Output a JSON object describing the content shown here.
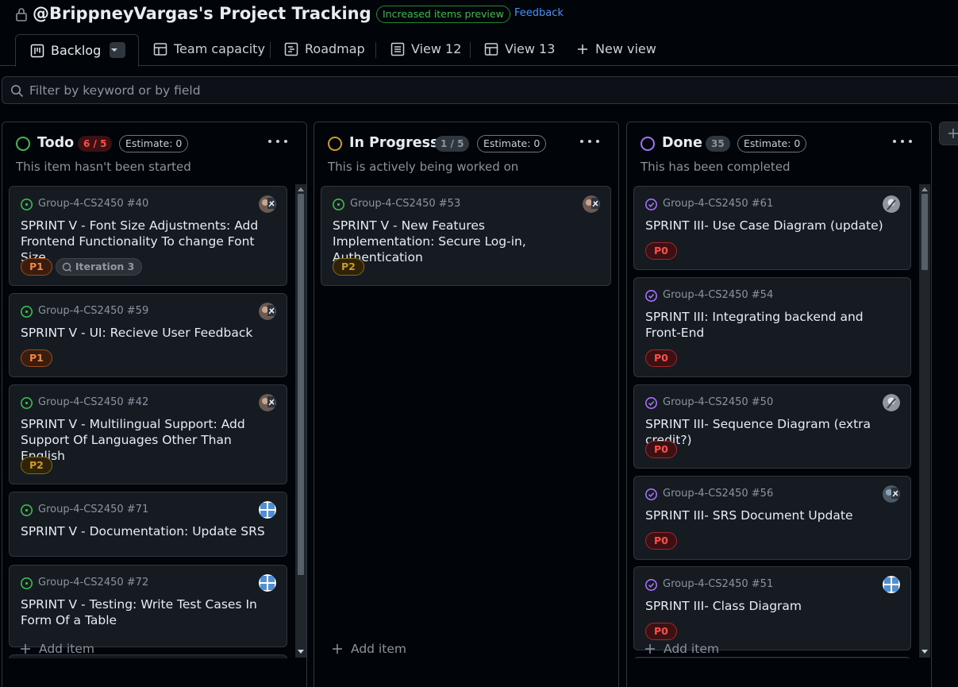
{
  "header": {
    "title": "@BrippneyVargas's Project Tracking",
    "preview_badge": "Increased items preview",
    "feedback_link": "Feedback"
  },
  "tabs": [
    {
      "label": "Backlog",
      "icon": "board-icon",
      "active": true
    },
    {
      "label": "Team capacity",
      "icon": "table-icon"
    },
    {
      "label": "Roadmap",
      "icon": "roadmap-icon"
    },
    {
      "label": "View 12",
      "icon": "list-icon"
    },
    {
      "label": "View 13",
      "icon": "table-icon"
    },
    {
      "label": "New view",
      "icon": "plus-icon"
    }
  ],
  "filter": {
    "placeholder": "Filter by keyword or by field"
  },
  "colors": {
    "todo": "#3fb950",
    "in_progress": "#d29922",
    "done": "#a371f7",
    "accent_link": "#4493f8"
  },
  "columns": [
    {
      "name": "Todo",
      "count": "6 / 5",
      "estimate": "Estimate: 0",
      "description": "This item hasn't been started",
      "add_item": "Add item",
      "cards": [
        {
          "repo": "Group-4-CS2450 #40",
          "title": "SPRINT V - Font Size Adjustments: Add Frontend Functionality To change Font Size",
          "labels": [
            {
              "text": "P1",
              "kind": "p1"
            },
            {
              "text": "Iteration 3",
              "kind": "iter"
            }
          ],
          "avatar": "avatar-pair"
        },
        {
          "repo": "Group-4-CS2450 #59",
          "title": "SPRINT V - UI: Recieve User Feedback",
          "labels": [
            {
              "text": "P1",
              "kind": "p1"
            }
          ],
          "avatar": "avatar-pair"
        },
        {
          "repo": "Group-4-CS2450 #42",
          "title": "SPRINT V - Multilingual Support: Add Support Of Languages Other Than English",
          "labels": [
            {
              "text": "P2",
              "kind": "p2"
            }
          ],
          "avatar": "avatar-pair"
        },
        {
          "repo": "Group-4-CS2450 #71",
          "title": "SPRINT V - Documentation: Update SRS",
          "labels": [],
          "avatar": "avatar-blue"
        },
        {
          "repo": "Group-4-CS2450 #72",
          "title": "SPRINT V - Testing: Write Test Cases In Form Of a Table",
          "labels": [],
          "avatar": "avatar-blue"
        }
      ]
    },
    {
      "name": "In Progress",
      "count": "1 / 5",
      "estimate": "Estimate: 0",
      "description": "This is actively being worked on",
      "add_item": "Add item",
      "cards": [
        {
          "repo": "Group-4-CS2450 #53",
          "title": "SPRINT V - New Features Implementation: Secure Log-in, Authentication",
          "labels": [
            {
              "text": "P2",
              "kind": "p2"
            }
          ],
          "avatar": "avatar-pair"
        }
      ]
    },
    {
      "name": "Done",
      "count": "35",
      "estimate": "Estimate: 0",
      "description": "This has been completed",
      "add_item": "Add item",
      "cards": [
        {
          "repo": "Group-4-CS2450 #61",
          "title": "SPRINT III- Use Case Diagram (update)",
          "labels": [
            {
              "text": "P0",
              "kind": "p0"
            }
          ],
          "avatar": "avatar-gray"
        },
        {
          "repo": "Group-4-CS2450 #54",
          "title": "SPRINT III: Integrating backend and Front-End",
          "labels": [
            {
              "text": "P0",
              "kind": "p0"
            }
          ],
          "avatar": "avatar-none"
        },
        {
          "repo": "Group-4-CS2450 #50",
          "title": "SPRINT III- Sequence Diagram (extra credit?)",
          "labels": [
            {
              "text": "P0",
              "kind": "p0"
            }
          ],
          "avatar": "avatar-gray"
        },
        {
          "repo": "Group-4-CS2450 #56",
          "title": "SPRINT III- SRS Document Update",
          "labels": [
            {
              "text": "P0",
              "kind": "p0"
            }
          ],
          "avatar": "avatar-pair"
        },
        {
          "repo": "Group-4-CS2450 #51",
          "title": "SPRINT III- Class Diagram",
          "labels": [
            {
              "text": "P0",
              "kind": "p0"
            }
          ],
          "avatar": "avatar-blue"
        }
      ]
    }
  ]
}
